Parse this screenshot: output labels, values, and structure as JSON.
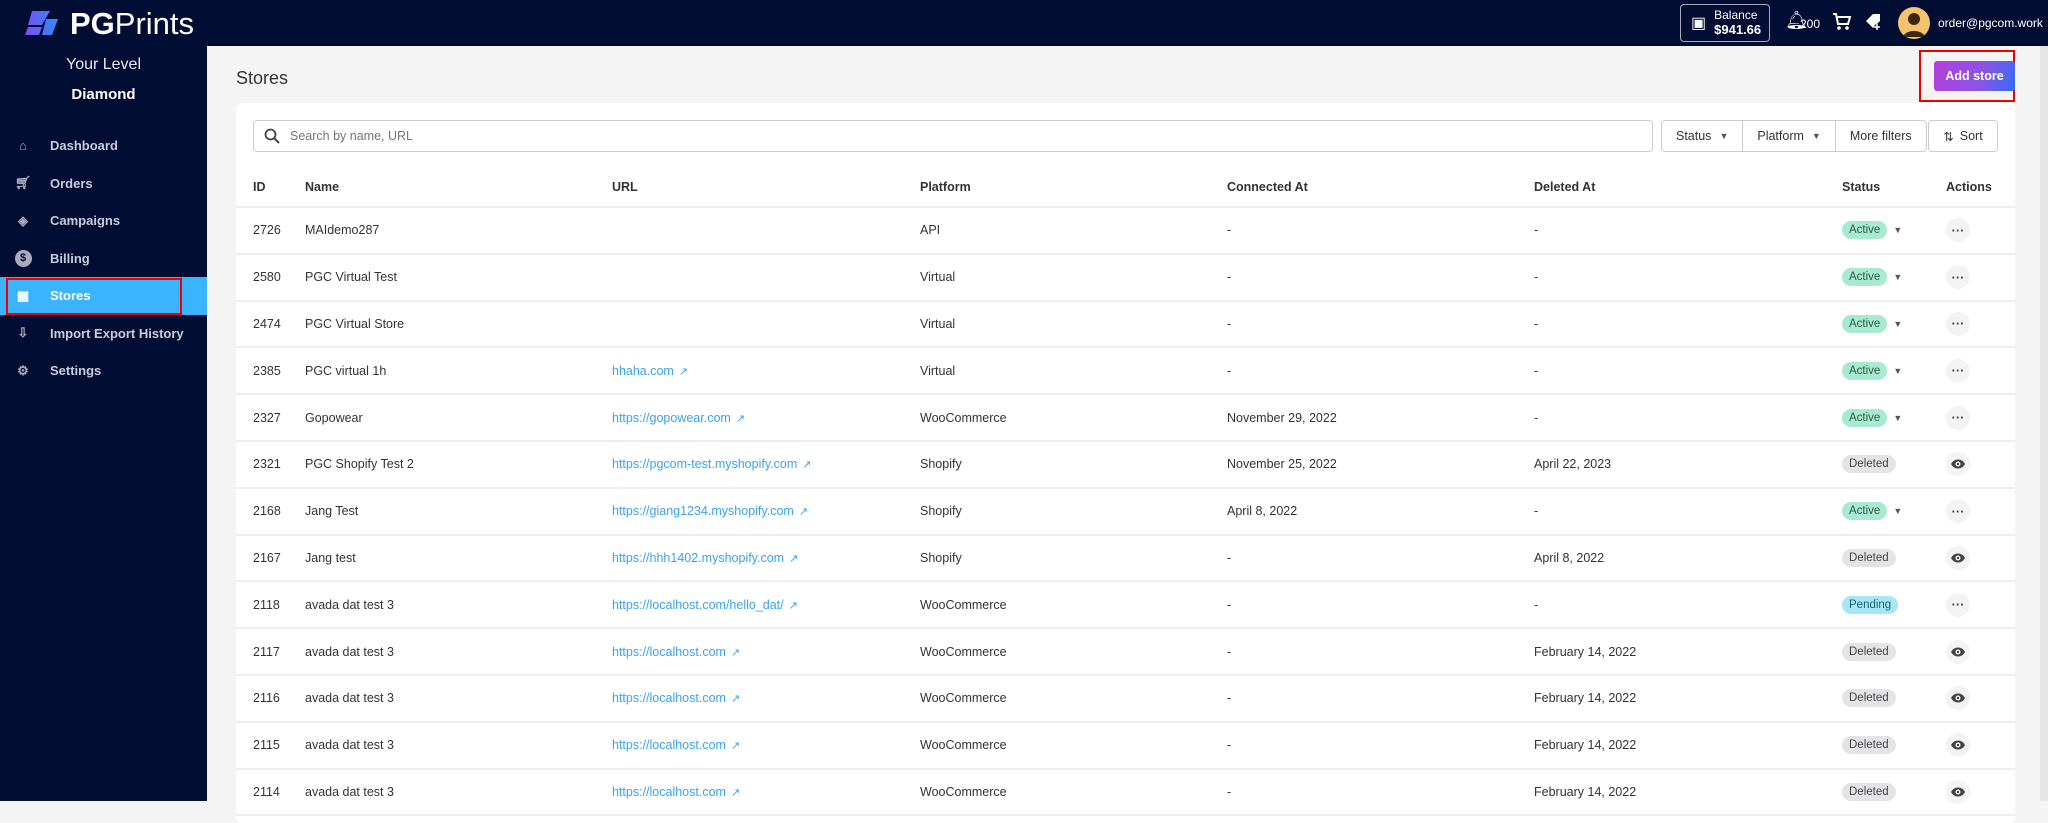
{
  "brand": {
    "name_bold": "PG",
    "name_rest": "Prints"
  },
  "topbar": {
    "balance_label": "Balance",
    "balance_value": "$941.66",
    "notifications": "200",
    "email": "order@pgcom.work"
  },
  "sidebar": {
    "level_label": "Your Level",
    "level_value": "Diamond",
    "items": [
      {
        "label": "Dashboard",
        "icon": "home-icon"
      },
      {
        "label": "Orders",
        "icon": "cart-icon"
      },
      {
        "label": "Campaigns",
        "icon": "tags-icon"
      },
      {
        "label": "Billing",
        "icon": "dollar-icon"
      },
      {
        "label": "Stores",
        "icon": "store-icon",
        "active": true
      },
      {
        "label": "Import Export History",
        "icon": "import-icon"
      },
      {
        "label": "Settings",
        "icon": "gear-icon"
      }
    ]
  },
  "page": {
    "title": "Stores",
    "add_button": "Add store"
  },
  "toolbar": {
    "search_placeholder": "Search by name, URL",
    "status": "Status",
    "platform": "Platform",
    "more_filters": "More filters",
    "sort": "Sort"
  },
  "table": {
    "headers": [
      "ID",
      "Name",
      "URL",
      "Platform",
      "Connected At",
      "Deleted At",
      "Status",
      "Actions"
    ],
    "rows": [
      [
        "2726",
        "MAIdemo287",
        "",
        "API",
        "-",
        "-",
        "Active"
      ],
      [
        "2580",
        "PGC Virtual Test",
        "",
        "Virtual",
        "-",
        "-",
        "Active"
      ],
      [
        "2474",
        "PGC Virtual Store",
        "",
        "Virtual",
        "-",
        "-",
        "Active"
      ],
      [
        "2385",
        "PGC virtual 1h",
        "hhaha.com",
        "Virtual",
        "-",
        "-",
        "Active"
      ],
      [
        "2327",
        "Gopowear",
        "https://gopowear.com",
        "WooCommerce",
        "November 29, 2022",
        "-",
        "Active"
      ],
      [
        "2321",
        "PGC Shopify Test 2",
        "https://pgcom-test.myshopify.com",
        "Shopify",
        "November 25, 2022",
        "April 22, 2023",
        "Deleted"
      ],
      [
        "2168",
        "Jang Test",
        "https://giang1234.myshopify.com",
        "Shopify",
        "April 8, 2022",
        "-",
        "Active"
      ],
      [
        "2167",
        "Jang test",
        "https://hhh1402.myshopify.com",
        "Shopify",
        "-",
        "April 8, 2022",
        "Deleted"
      ],
      [
        "2118",
        "avada dat test 3",
        "https://localhost.com/hello_dat/",
        "WooCommerce",
        "-",
        "-",
        "Pending"
      ],
      [
        "2117",
        "avada dat test 3",
        "https://localhost.com",
        "WooCommerce",
        "-",
        "February 14, 2022",
        "Deleted"
      ],
      [
        "2116",
        "avada dat test 3",
        "https://localhost.com",
        "WooCommerce",
        "-",
        "February 14, 2022",
        "Deleted"
      ],
      [
        "2115",
        "avada dat test 3",
        "https://localhost.com",
        "WooCommerce",
        "-",
        "February 14, 2022",
        "Deleted"
      ],
      [
        "2114",
        "avada dat test 3",
        "https://localhost.com",
        "WooCommerce",
        "-",
        "February 14, 2022",
        "Deleted"
      ]
    ]
  }
}
